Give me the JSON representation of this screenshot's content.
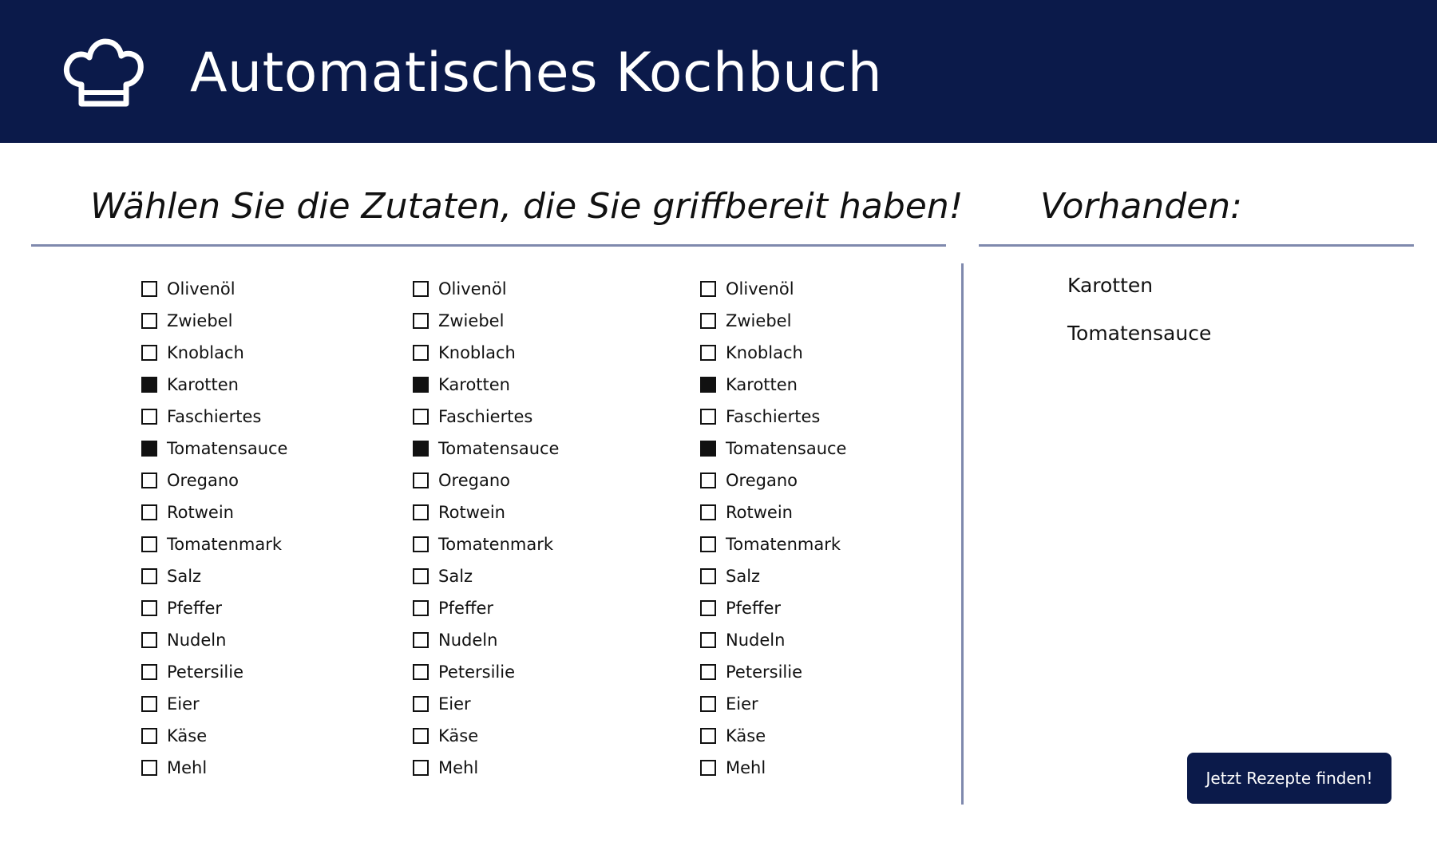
{
  "header": {
    "title": "Automatisches Kochbuch",
    "logo_icon": "chef-hat-icon",
    "background": "#0b1a4a"
  },
  "ingredients_section": {
    "heading": "Wählen Sie die Zutaten, die Sie griffbereit haben!",
    "columns": [
      {
        "items": [
          {
            "label": "Olivenöl",
            "checked": false
          },
          {
            "label": "Zwiebel",
            "checked": false
          },
          {
            "label": "Knoblach",
            "checked": false
          },
          {
            "label": "Karotten",
            "checked": true
          },
          {
            "label": "Faschiertes",
            "checked": false
          },
          {
            "label": "Tomatensauce",
            "checked": true
          },
          {
            "label": "Oregano",
            "checked": false
          },
          {
            "label": "Rotwein",
            "checked": false
          },
          {
            "label": "Tomatenmark",
            "checked": false
          },
          {
            "label": "Salz",
            "checked": false
          },
          {
            "label": "Pfeffer",
            "checked": false
          },
          {
            "label": "Nudeln",
            "checked": false
          },
          {
            "label": "Petersilie",
            "checked": false
          },
          {
            "label": "Eier",
            "checked": false
          },
          {
            "label": "Käse",
            "checked": false
          },
          {
            "label": "Mehl",
            "checked": false
          }
        ]
      },
      {
        "items": [
          {
            "label": "Olivenöl",
            "checked": false
          },
          {
            "label": "Zwiebel",
            "checked": false
          },
          {
            "label": "Knoblach",
            "checked": false
          },
          {
            "label": "Karotten",
            "checked": true
          },
          {
            "label": "Faschiertes",
            "checked": false
          },
          {
            "label": "Tomatensauce",
            "checked": true
          },
          {
            "label": "Oregano",
            "checked": false
          },
          {
            "label": "Rotwein",
            "checked": false
          },
          {
            "label": "Tomatenmark",
            "checked": false
          },
          {
            "label": "Salz",
            "checked": false
          },
          {
            "label": "Pfeffer",
            "checked": false
          },
          {
            "label": "Nudeln",
            "checked": false
          },
          {
            "label": "Petersilie",
            "checked": false
          },
          {
            "label": "Eier",
            "checked": false
          },
          {
            "label": "Käse",
            "checked": false
          },
          {
            "label": "Mehl",
            "checked": false
          }
        ]
      },
      {
        "items": [
          {
            "label": "Olivenöl",
            "checked": false
          },
          {
            "label": "Zwiebel",
            "checked": false
          },
          {
            "label": "Knoblach",
            "checked": false
          },
          {
            "label": "Karotten",
            "checked": true
          },
          {
            "label": "Faschiertes",
            "checked": false
          },
          {
            "label": "Tomatensauce",
            "checked": true
          },
          {
            "label": "Oregano",
            "checked": false
          },
          {
            "label": "Rotwein",
            "checked": false
          },
          {
            "label": "Tomatenmark",
            "checked": false
          },
          {
            "label": "Salz",
            "checked": false
          },
          {
            "label": "Pfeffer",
            "checked": false
          },
          {
            "label": "Nudeln",
            "checked": false
          },
          {
            "label": "Petersilie",
            "checked": false
          },
          {
            "label": "Eier",
            "checked": false
          },
          {
            "label": "Käse",
            "checked": false
          },
          {
            "label": "Mehl",
            "checked": false
          }
        ]
      }
    ]
  },
  "available_section": {
    "heading": "Vorhanden:",
    "items": [
      "Karotten",
      "Tomatensauce"
    ]
  },
  "actions": {
    "find_button_label": "Jetzt Rezepte finden!"
  },
  "colors": {
    "primary": "#0b1a4a",
    "divider": "#7f89ad"
  }
}
